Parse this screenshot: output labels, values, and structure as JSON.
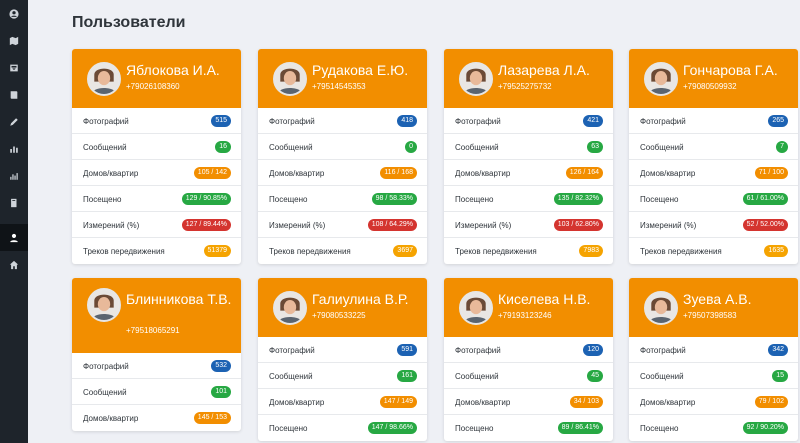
{
  "page": {
    "title": "Пользователи"
  },
  "colors": {
    "accent": "#f28e00",
    "blue": "#1c62b3",
    "green": "#27a843",
    "orange": "#f28e00",
    "red": "#d4342f",
    "yellow": "#f5a300"
  },
  "sidebar": {
    "items": [
      {
        "icon": "user-circle-icon",
        "active": true
      },
      {
        "icon": "map-icon",
        "active": false
      },
      {
        "icon": "inbox-icon",
        "active": false
      },
      {
        "icon": "book-icon",
        "active": false
      },
      {
        "icon": "pencil-icon",
        "active": false
      },
      {
        "icon": "bar-chart-icon",
        "active": false
      },
      {
        "icon": "bar-chart-alt-icon",
        "active": false
      },
      {
        "icon": "book-alt-icon",
        "active": false
      },
      {
        "icon": "user-icon",
        "active": true
      },
      {
        "icon": "home-icon",
        "active": false
      }
    ]
  },
  "labels": {
    "photos": "Фотографий",
    "messages": "Сообщений",
    "houses": "Домов/квартир",
    "visited": "Посещено",
    "measurements": "Измерений (%)",
    "tracks": "Треков передвижения"
  },
  "cards": [
    {
      "name": "Яблокова И.А.",
      "phone": "+79026108360",
      "stats": {
        "photos": "515",
        "messages": "16",
        "houses": "105 / 142",
        "visited": "129 / 90.85%",
        "measurements": "127 / 89.44%",
        "tracks": "51379"
      }
    },
    {
      "name": "Рудакова Е.Ю.",
      "phone": "+79514545353",
      "stats": {
        "photos": "418",
        "messages": "0",
        "houses": "116 / 168",
        "visited": "98 / 58.33%",
        "measurements": "108 / 64.29%",
        "tracks": "3697"
      }
    },
    {
      "name": "Лазарева Л.А.",
      "phone": "+79525275732",
      "stats": {
        "photos": "421",
        "messages": "63",
        "houses": "126 / 164",
        "visited": "135 / 82.32%",
        "measurements": "103 / 62.80%",
        "tracks": "7983"
      }
    },
    {
      "name": "Гончарова Г.А.",
      "phone": "+79080509932",
      "stats": {
        "photos": "265",
        "messages": "7",
        "houses": "71 / 100",
        "visited": "61 / 61.00%",
        "measurements": "52 / 52.00%",
        "tracks": "1635"
      }
    },
    {
      "name": "Блинникова Т.В.",
      "phone": "+79518065291",
      "stats": {
        "photos": "532",
        "messages": "101",
        "houses": "145 / 153"
      }
    },
    {
      "name": "Галиулина В.Р.",
      "phone": "+79080533225",
      "stats": {
        "photos": "591",
        "messages": "161",
        "houses": "147 / 149",
        "visited": "147 / 98.66%"
      }
    },
    {
      "name": "Киселева Н.В.",
      "phone": "+79193123246",
      "stats": {
        "photos": "120",
        "messages": "45",
        "houses": "34 / 103",
        "visited": "89 / 86.41%"
      }
    },
    {
      "name": "Зуева А.В.",
      "phone": "+79507398583",
      "stats": {
        "photos": "342",
        "messages": "15",
        "houses": "79 / 102",
        "visited": "92 / 90.20%"
      }
    }
  ]
}
